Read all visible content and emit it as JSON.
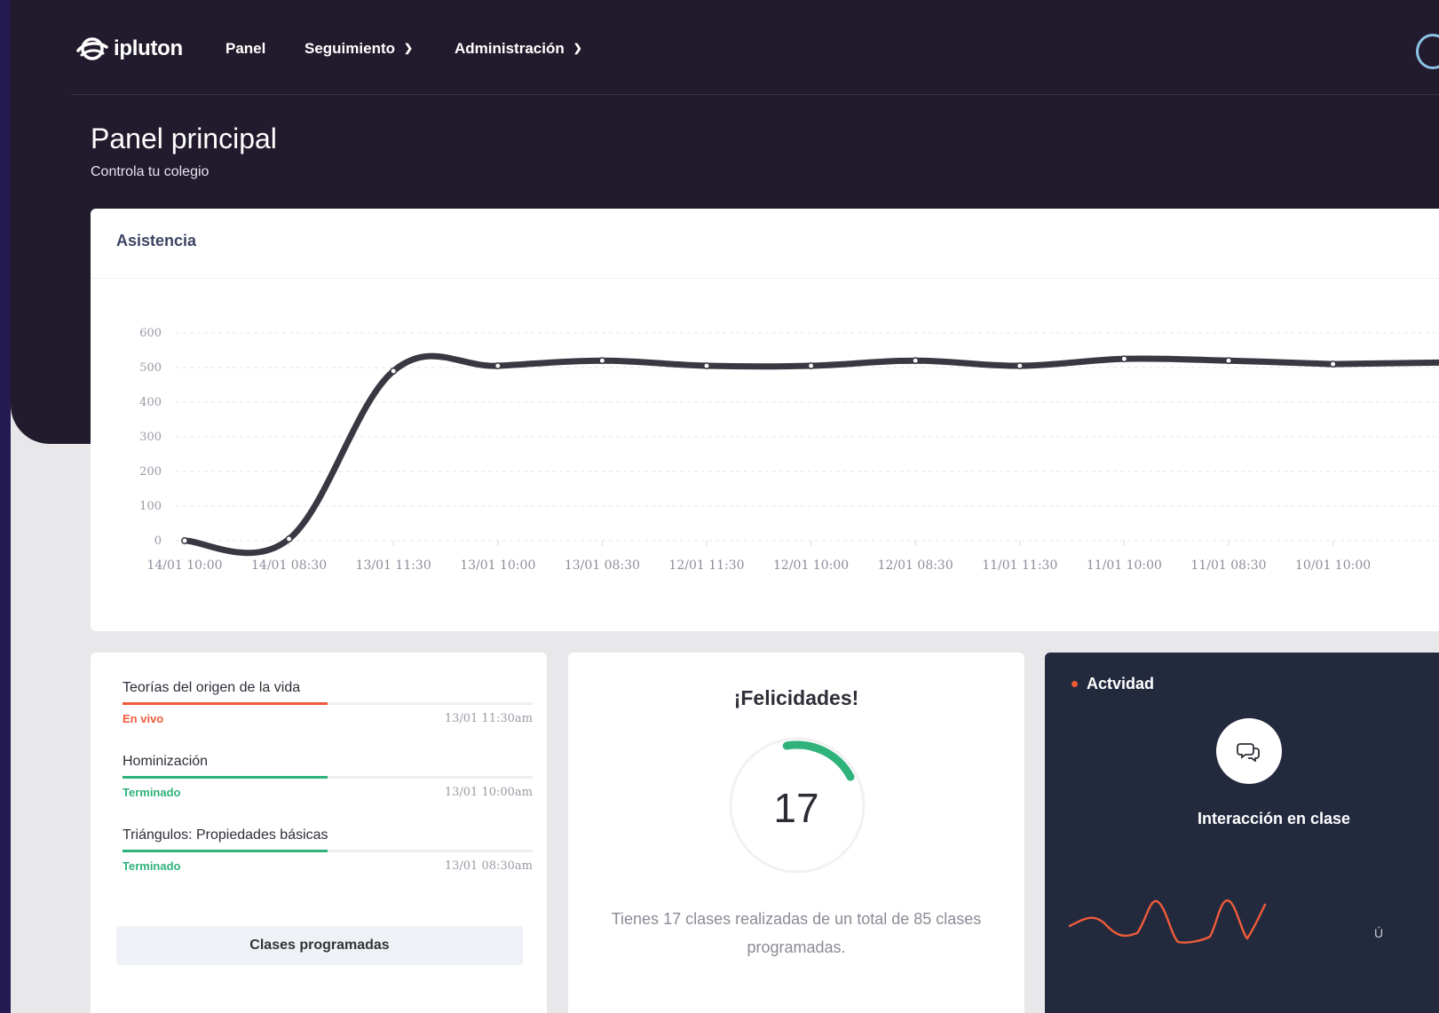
{
  "brand": {
    "name": "ipluton"
  },
  "nav": {
    "items": [
      {
        "label": "Panel"
      },
      {
        "label": "Seguimiento"
      },
      {
        "label": "Administración"
      }
    ]
  },
  "page": {
    "title": "Panel principal",
    "subtitle": "Controla tu colegio"
  },
  "attendance": {
    "title": "Asistencia",
    "chart_data": {
      "type": "line",
      "title": "Asistencia",
      "xlabel": "",
      "ylabel": "",
      "categories": [
        "14/01 10:00",
        "14/01 08:30",
        "13/01 11:30",
        "13/01 10:00",
        "13/01 08:30",
        "12/01 11:30",
        "12/01 10:00",
        "12/01 08:30",
        "11/01 11:30",
        "11/01 10:00",
        "11/01 08:30",
        "10/01 10:00"
      ],
      "series": [
        {
          "values": [
            0,
            5,
            490,
            505,
            520,
            505,
            505,
            520,
            505,
            525,
            520,
            510
          ]
        }
      ],
      "ylim": [
        0,
        600
      ],
      "yticks": [
        0,
        100,
        200,
        300,
        400,
        500,
        600
      ],
      "grid": true,
      "color": "#3a3742"
    }
  },
  "classes": {
    "items": [
      {
        "title": "Teorías del origen de la vida",
        "status": "En vivo",
        "time": "13/01 11:30am",
        "status_color": "#ef5b3a",
        "progress": 0.5
      },
      {
        "title": "Hominización",
        "status": "Terminado",
        "time": "13/01 10:00am",
        "status_color": "#2fb37b",
        "progress": 0.5
      },
      {
        "title": "Triángulos: Propiedades básicas",
        "status": "Terminado",
        "time": "13/01 08:30am",
        "status_color": "#2fb37b",
        "progress": 0.5
      }
    ],
    "button_label": "Clases programadas"
  },
  "congrats": {
    "title": "¡Felicidades!",
    "value": "17",
    "done": 17,
    "total": 85,
    "text": "Tienes 17 clases realizadas de un total de 85 clases programadas.",
    "accent": "#2fb37b"
  },
  "activity": {
    "title": "Actvidad",
    "icon": "chat-bubbles-icon",
    "label": "Interacción en clase",
    "edge_text": "Ú",
    "spark_color": "#ef5b3a"
  }
}
